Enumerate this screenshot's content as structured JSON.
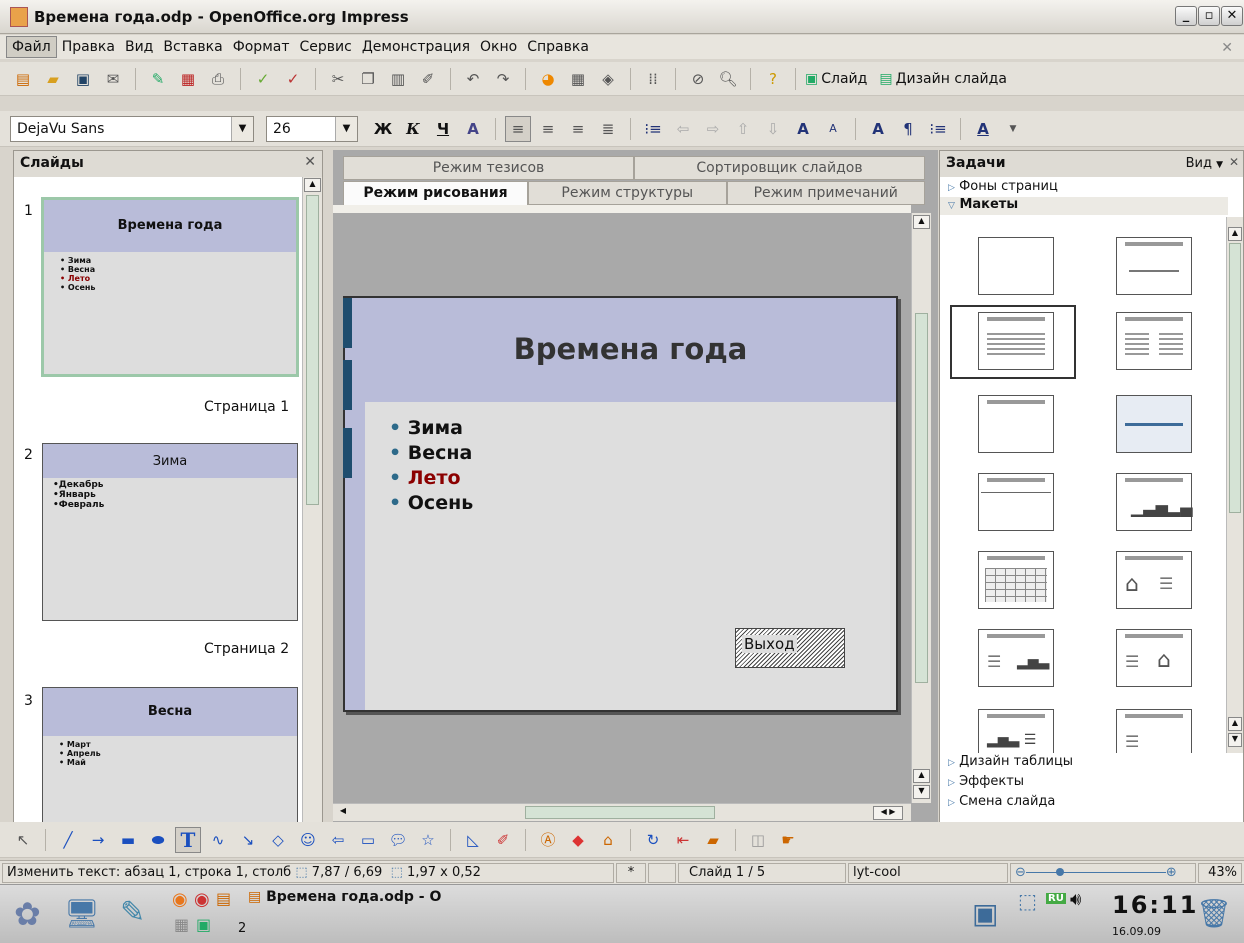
{
  "window": {
    "title": "Времена года.odp - OpenOffice.org Impress"
  },
  "menu": [
    "Файл",
    "Правка",
    "Вид",
    "Вставка",
    "Формат",
    "Сервис",
    "Демонстрация",
    "Окно",
    "Справка"
  ],
  "toolbar1": {
    "slide_label": "Слайд",
    "design_label": "Дизайн слайда"
  },
  "format_toolbar": {
    "font_name": "DejaVu Sans",
    "font_size": "26",
    "bold": "Ж",
    "italic": "К",
    "underline": "Ч"
  },
  "slides_panel": {
    "title": "Слайды",
    "slides": [
      {
        "num": "1",
        "title": "Времена года",
        "items": [
          "Зима",
          "Весна",
          "Лето",
          "Осень"
        ],
        "caption": "Страница 1"
      },
      {
        "num": "2",
        "title": "Зима",
        "items": [
          "Декабрь",
          "Январь",
          "Февраль"
        ],
        "caption": "Страница 2"
      },
      {
        "num": "3",
        "title": "Весна",
        "items": [
          "Март",
          "Апрель",
          "Май"
        ]
      }
    ]
  },
  "view_tabs": {
    "top": [
      "Режим тезисов",
      "Сортировщик слайдов"
    ],
    "bottom": [
      "Режим рисования",
      "Режим структуры",
      "Режим примечаний"
    ]
  },
  "slide": {
    "title": "Времена года",
    "bullets": [
      "Зима",
      "Весна",
      "Лето",
      "Осень"
    ],
    "exit_button": "Выход",
    "highlight_color": "#8b0000"
  },
  "tasks_panel": {
    "title": "Задачи",
    "view_label": "Вид",
    "sections": [
      "Фоны страниц",
      "Макеты",
      "Дизайн таблицы",
      "Эффекты",
      "Смена слайда"
    ]
  },
  "statusbar": {
    "edit": "Изменить текст: абзац 1, строка 1, столб",
    "position": "7,87 / 6,69",
    "size": "1,97 x 0,52",
    "modified": "*",
    "slide": "Слайд 1 / 5",
    "layout": "lyt-cool",
    "zoom": "43%"
  },
  "taskbar": {
    "task": "Времена года.odp - O",
    "desktop_num": "2",
    "lang": "RU",
    "clock": "16:11",
    "date": "16.09.09"
  }
}
